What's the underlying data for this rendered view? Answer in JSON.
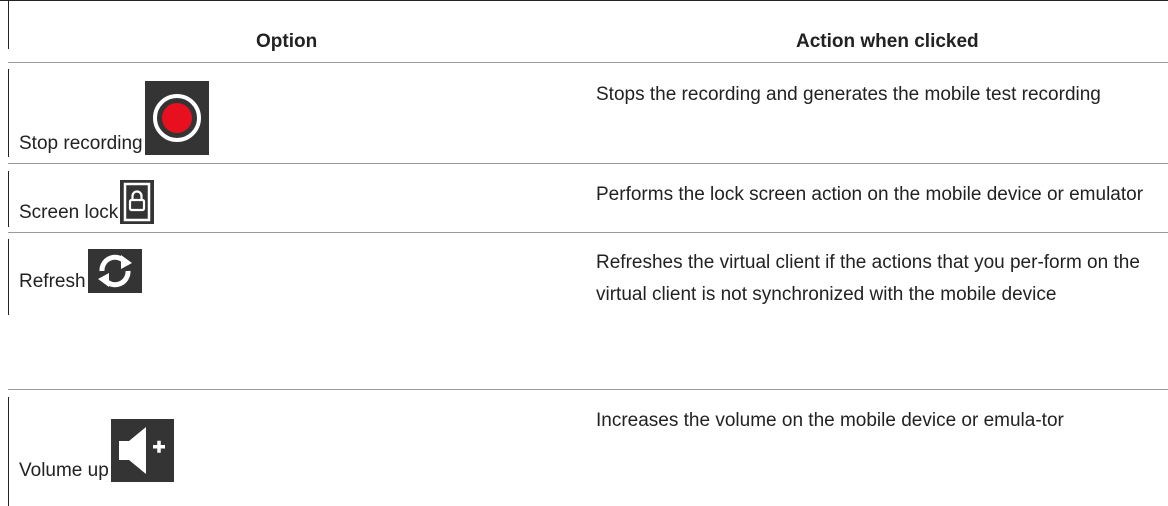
{
  "table": {
    "headers": {
      "option": "Option",
      "action": "Action when clicked"
    },
    "rows": [
      {
        "option": "Stop recording",
        "icon": "record-stop-icon",
        "action": "Stops the recording and generates the mobile test recording"
      },
      {
        "option": "Screen lock",
        "icon": "lock-icon",
        "action": "Performs the lock screen action on the mobile device or emulator"
      },
      {
        "option": "Refresh",
        "icon": "refresh-icon",
        "action": "Refreshes the virtual client if the actions that you per-form on the virtual client is not synchronized with the mobile device"
      },
      {
        "option": "Volume up",
        "icon": "volume-up-icon",
        "action": "Increases the volume on the mobile device or emula-tor"
      }
    ]
  },
  "colors": {
    "icon_background": "#343434",
    "record_dot": "#e8101e",
    "text": "#222222"
  }
}
